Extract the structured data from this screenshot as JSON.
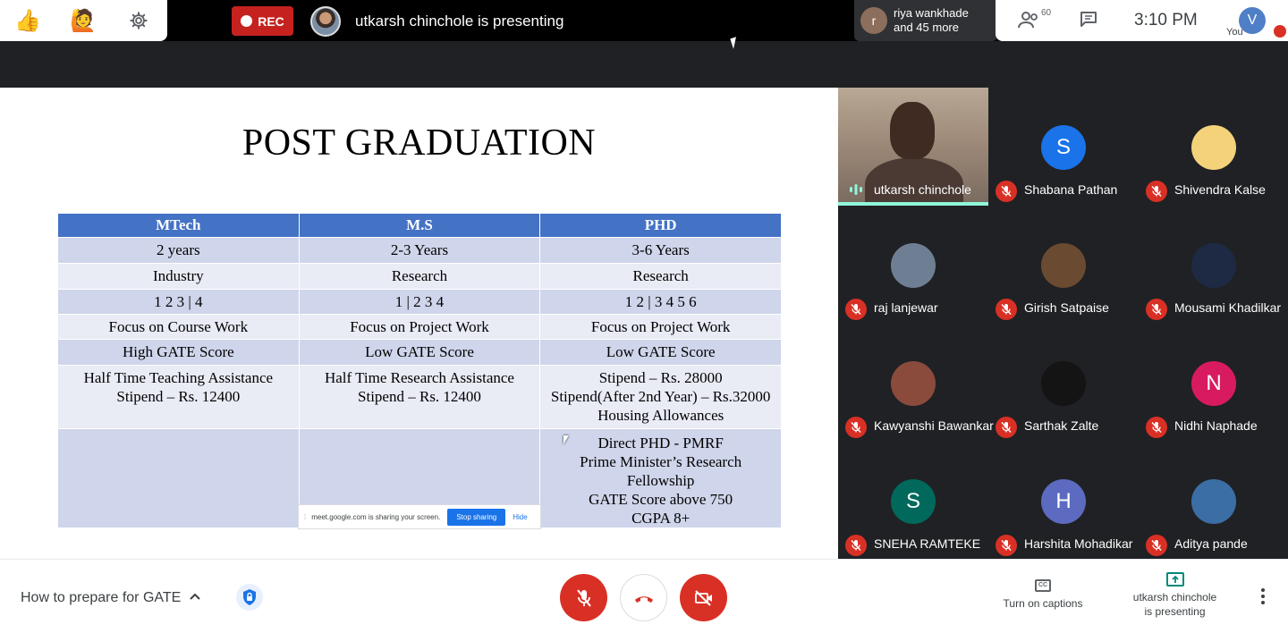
{
  "topbar": {
    "rec_label": "REC",
    "presenting_text": "utkarsh chinchole is presenting",
    "others_text_line1": "riya wankhade",
    "others_text_line2": "and 45 more",
    "others_avatar_letter": "r",
    "people_count": "60",
    "clock": "3:10 PM",
    "you_letter": "V",
    "you_label": "You"
  },
  "slide": {
    "title": "POST GRADUATION",
    "headers": [
      "MTech",
      "M.S",
      "PHD"
    ],
    "rows": [
      [
        "2 years",
        "2-3 Years",
        "3-6 Years"
      ],
      [
        "Industry",
        "Research",
        "Research"
      ],
      [
        "1 2 3 | 4",
        "1 | 2 3 4",
        "1 2 | 3 4 5 6"
      ],
      [
        "Focus on Course Work",
        "Focus on Project Work",
        "Focus on Project Work"
      ],
      [
        "High GATE Score",
        "Low GATE Score",
        "Low GATE Score"
      ],
      [
        "Half Time Teaching Assistance\nStipend – Rs. 12400",
        "Half Time Research Assistance\nStipend – Rs. 12400",
        "Stipend – Rs. 28000\nStipend(After 2nd Year) – Rs.32000\nHousing Allowances"
      ],
      [
        "",
        "",
        "Direct PHD - PMRF\nPrime Minister’s Research Fellowship\nGATE Score above 750\nCGPA 8+"
      ]
    ]
  },
  "share_bar": {
    "text": "meet.google.com is sharing your screen.",
    "stop_label": "Stop sharing",
    "hide_label": "Hide"
  },
  "participants": [
    {
      "name": "utkarsh chinchole",
      "type": "video"
    },
    {
      "name": "Shabana Pathan",
      "letter": "S",
      "color": "#1a73e8"
    },
    {
      "name": "Shivendra Kalse",
      "letter": "",
      "color": "#f3d27a"
    },
    {
      "name": "raj lanjewar",
      "letter": "",
      "color": "#6e7f93"
    },
    {
      "name": "Girish Satpaise",
      "letter": "",
      "color": "#6b4a32"
    },
    {
      "name": "Mousami Khadilkar",
      "letter": "",
      "color": "#1e2a44"
    },
    {
      "name": "Kawyanshi Bawankar",
      "letter": "",
      "color": "#8a4b3c"
    },
    {
      "name": "Sarthak Zalte",
      "letter": "",
      "color": "#141414"
    },
    {
      "name": "Nidhi Naphade",
      "letter": "N",
      "color": "#d81b60"
    },
    {
      "name": "SNEHA RAMTEKE",
      "letter": "S",
      "color": "#00695c"
    },
    {
      "name": "Harshita Mohadikar",
      "letter": "H",
      "color": "#5c6bc0"
    },
    {
      "name": "Aditya pande",
      "letter": "",
      "color": "#3b6ea5"
    }
  ],
  "bottombar": {
    "meeting_title": "How to prepare for GATE",
    "captions_label": "Turn on captions",
    "captions_icon_text": "CC",
    "presenting_line1": "utkarsh chinchole",
    "presenting_line2": "is presenting"
  }
}
